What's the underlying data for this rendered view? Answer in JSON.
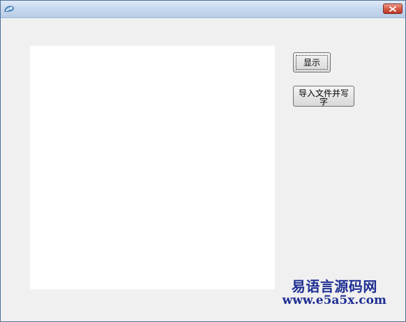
{
  "window": {
    "title": ""
  },
  "toolbar": {
    "show_label": "显示",
    "import_label": "导入文件并写字"
  },
  "watermark": {
    "title": "易语言源码网",
    "url": "www.e5a5x.com"
  },
  "colors": {
    "window_bg": "#f0f0f0",
    "canvas_bg": "#ffffff",
    "watermark": "#1f2f93",
    "close_red": "#c44a34"
  },
  "icons": {
    "app": "app-icon",
    "close": "close-icon"
  }
}
